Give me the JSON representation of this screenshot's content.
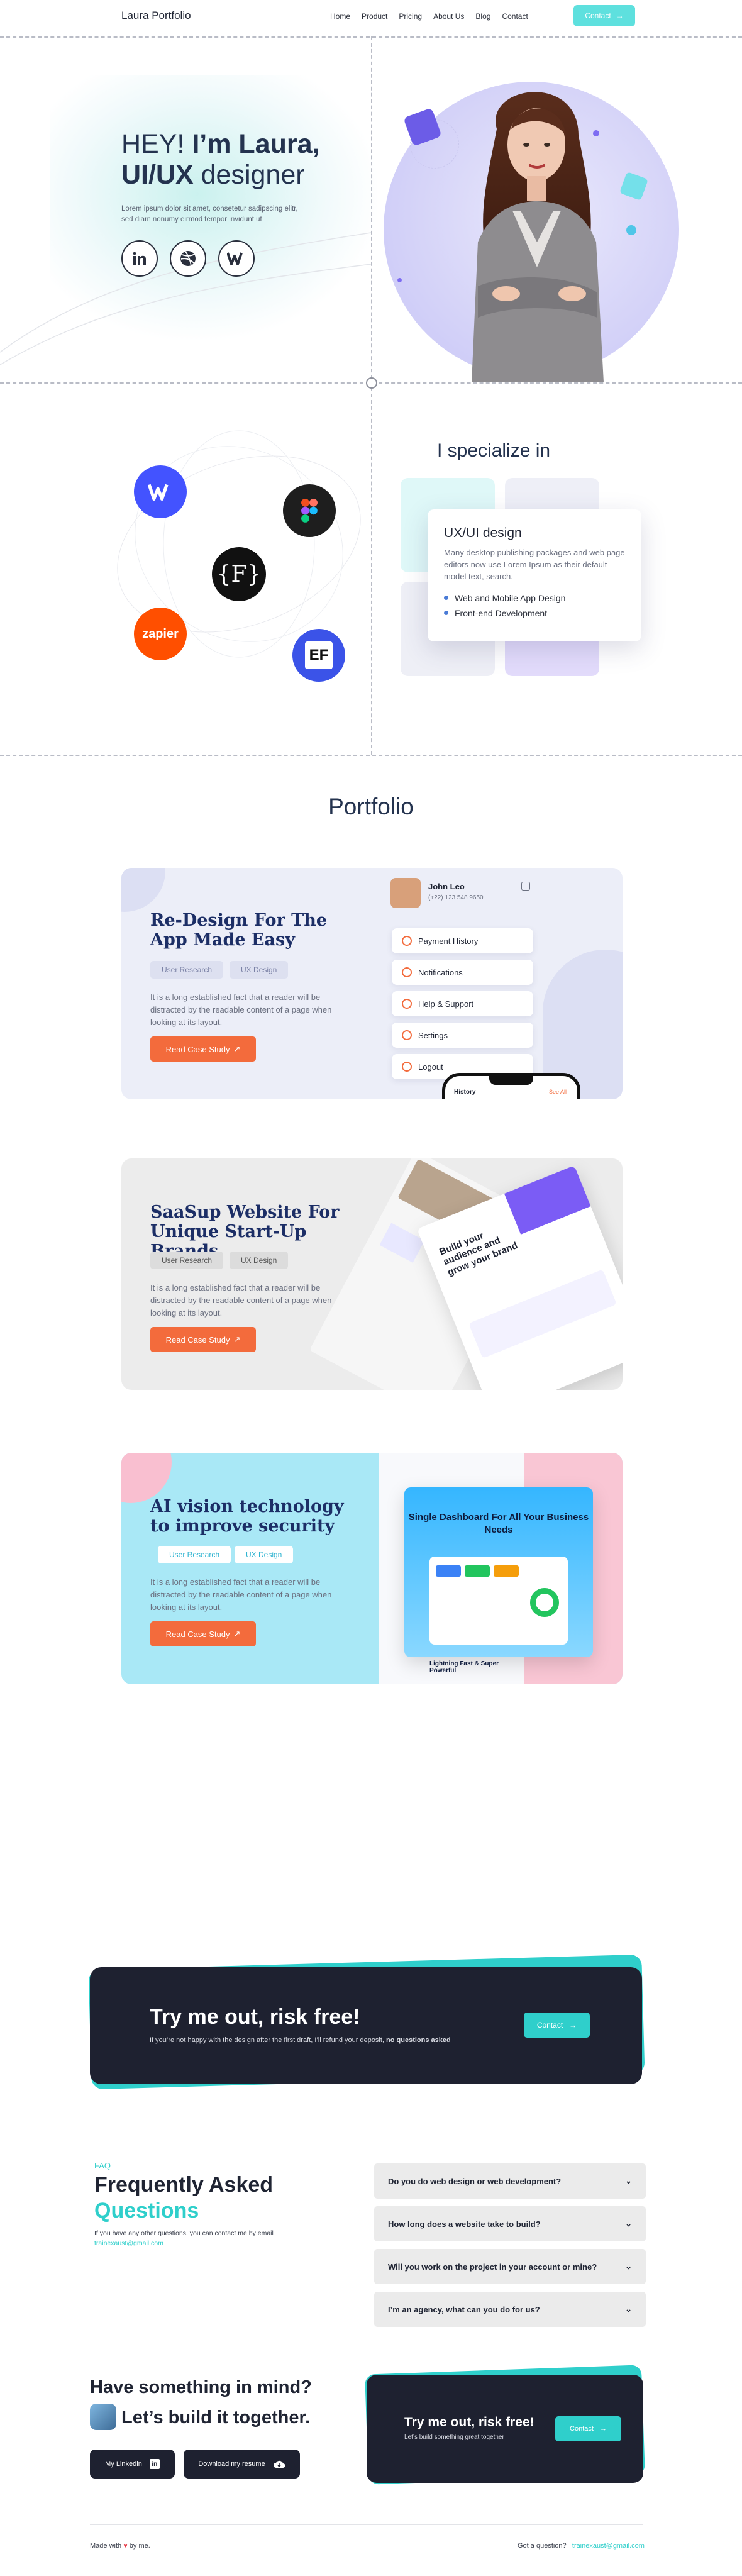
{
  "nav": {
    "logo": "Laura Portfolio",
    "items": [
      "Home",
      "Product",
      "Pricing",
      "About Us",
      "Blog",
      "Contact"
    ],
    "contact_button": "Contact"
  },
  "hero": {
    "greeting": "HEY! ",
    "name": "I’m Laura,",
    "role_bold": "UI/UX",
    "role_rest": " designer",
    "description": "Lorem ipsum dolor sit amet, consetetur sadipscing elitr, sed diam nonumy eirmod tempor invidunt ut",
    "socials": [
      "linkedin-icon",
      "dribbble-icon",
      "webflow-icon"
    ]
  },
  "specialize": {
    "title": "I specialize in",
    "card_title": "UX/UI design",
    "card_text": "Many desktop publishing packages and web page editors now use Lorem Ipsum as their default model text, search.",
    "bullets": [
      "Web and Mobile App Design",
      "Front-end Development"
    ],
    "tools": [
      "webflow-icon",
      "figma-icon",
      "framer-icon",
      "zapier-icon",
      "elementor-icon"
    ],
    "zapier_label": "zapier"
  },
  "portfolio": {
    "title": "Portfolio",
    "read_label": "Read Case Study",
    "cards": [
      {
        "title": "Re-Design For The App Made Easy",
        "tags": [
          "User Research",
          "UX Design"
        ],
        "desc": "It is a long established fact that a reader will be distracted by the readable content of a page when looking at its layout.",
        "profile_name": "John Leo",
        "profile_phone": "(+22) 123 548 9650",
        "menu": [
          "Payment History",
          "Notifications",
          "Help & Support",
          "Settings",
          "Logout"
        ],
        "phone_label": "History",
        "phone_link": "See All"
      },
      {
        "title": "SaaSup Website For Unique Start-Up Brands",
        "tags": [
          "User Research",
          "UX Design"
        ],
        "desc": "It is a long established fact that a reader will be distracted by the readable content of a page when looking at its layout.",
        "mock_heading": "Build your audience and grow your brand"
      },
      {
        "title": "AI vision technology to improve security",
        "tags": [
          "User Research",
          "UX Design"
        ],
        "desc": "It is a long established fact that a reader will be distracted by the readable content of a page when looking at its layout.",
        "mock_heading": "Single Dashboard For All Your Business Needs",
        "mock_sub": "Lightning Fast & Super Powerful"
      }
    ]
  },
  "cta": {
    "title": "Try me out, risk free!",
    "subtitle": "If you’re not happy with the design after the first draft, I’ll refund your deposit, ",
    "subtitle_bold": "no questions asked",
    "button": "Contact"
  },
  "faq": {
    "label": "FAQ",
    "title_line1": "Frequently Asked",
    "title_line2": "Questions",
    "note": "If you have any other questions, you can contact me by email",
    "email": "trainexaust@gmail.com",
    "questions": [
      "Do you do web design or web development?",
      "How long does a website take to build?",
      "Will you work on the project in your account or mine?",
      "I’m an agency, what can you do for us?"
    ]
  },
  "bottom": {
    "title": "Have something in mind?",
    "subtitle": "Let’s build it together.",
    "linkedin_button": "My Linkedin",
    "resume_button": "Download my resume",
    "mini_title": "Try me out, risk free!",
    "mini_sub": "Let’s build something great together",
    "mini_button": "Contact"
  },
  "footer": {
    "made_with_prefix": "Made with",
    "made_with_suffix": "by me.",
    "question": "Got a question?",
    "email": "trainexaust@gmail.com"
  },
  "colors": {
    "accent": "#2fcfcb",
    "orange": "#f36b3c",
    "dark": "#1e2130",
    "navy": "#1c2e66",
    "lavender": "#cdcbf7"
  }
}
